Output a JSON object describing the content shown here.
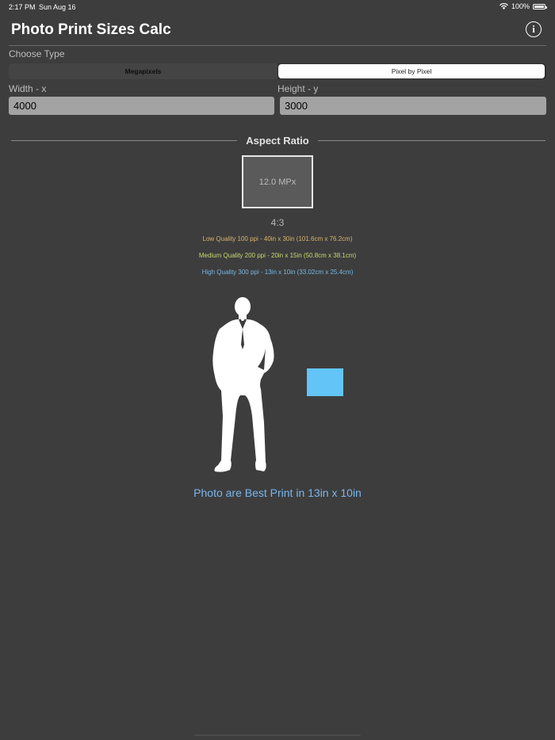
{
  "status": {
    "time": "2:17 PM",
    "date": "Sun Aug 16",
    "battery": "100%"
  },
  "header": {
    "title": "Photo Print Sizes Calc",
    "info_glyph": "i"
  },
  "type_selector": {
    "label": "Choose Type",
    "options": [
      "Megapixels",
      "Pixel by Pixel"
    ],
    "selected": "Pixel by Pixel"
  },
  "width": {
    "label": "Width - x",
    "value": "4000"
  },
  "height": {
    "label": "Height - y",
    "value": "3000"
  },
  "aspect": {
    "title": "Aspect Ratio",
    "megapixels": "12.0 MPx",
    "ratio": "4:3"
  },
  "qualities": {
    "low": "Low Quality 100 ppi - 40in x 30in (101.6cm x 76.2cm)",
    "medium": "Medium Quality 200 ppi - 20in x 15in (50.8cm x 38.1cm)",
    "high": "High Quality 300 ppi - 13in x 10in (33.02cm x 25.4cm)"
  },
  "result": "Photo are Best Print in 13in x 10in",
  "colors": {
    "background": "#3d3d3d",
    "low_quality": "#d9b36c",
    "medium_quality": "#c6da6e",
    "high_quality": "#76b8e3",
    "photo_preview": "#63c4f7",
    "result_text": "#7ab6ee"
  },
  "icons": [
    "wifi-icon",
    "battery-icon",
    "info-icon",
    "man-silhouette"
  ]
}
